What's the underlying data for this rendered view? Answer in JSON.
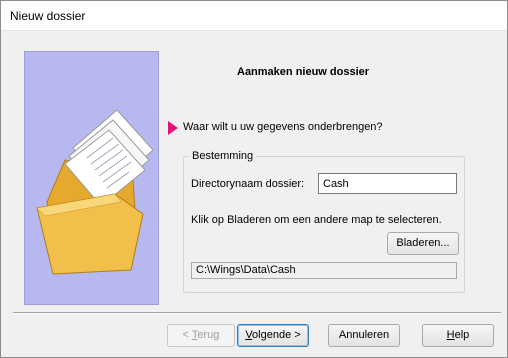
{
  "window": {
    "title": "Nieuw dossier"
  },
  "wizard": {
    "heading": "Aanmaken nieuw dossier",
    "question": "Waar wilt u uw gegevens onderbrengen?",
    "question_icon": "pointer-arrow-icon",
    "side_image": "folder-with-documents-illustration"
  },
  "destination": {
    "legend": "Bestemming",
    "dir_label": "Directorynaam dossier:",
    "dir_value": "Cash",
    "hint": "Klik op Bladeren om een andere map te selecteren.",
    "browse_label": "Bladeren...",
    "path": "C:\\Wings\\Data\\Cash"
  },
  "buttons": {
    "back_prefix": "< ",
    "back_mnemonic": "T",
    "back_rest": "erug",
    "next_mnemonic": "V",
    "next_rest": "olgende >",
    "cancel": "Annuleren",
    "help_mnemonic": "H",
    "help_rest": "elp"
  },
  "colors": {
    "side_panel": "#b8b8f0",
    "pointer": "#e0147a",
    "folder": "#f2c04a"
  }
}
